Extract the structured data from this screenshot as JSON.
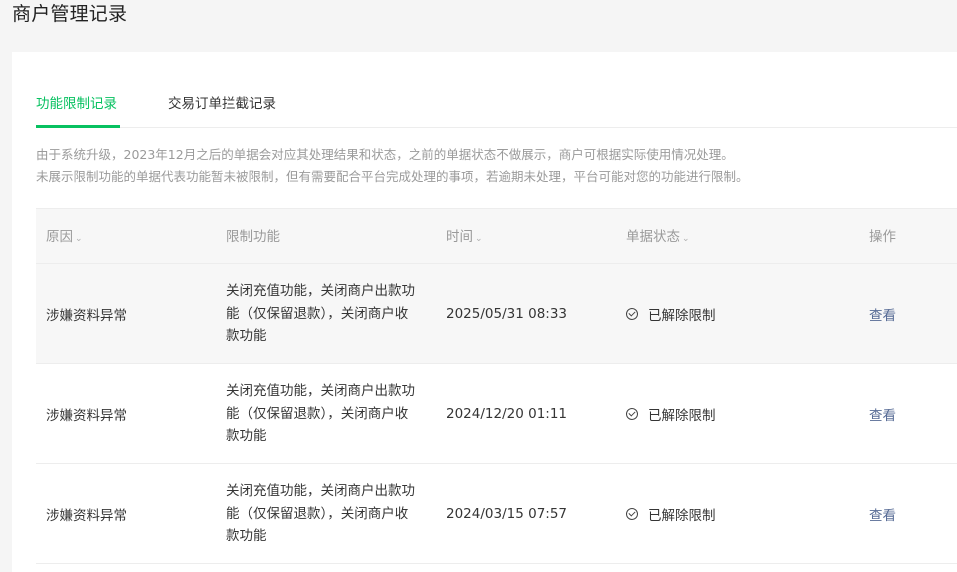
{
  "page": {
    "title": "商户管理记录"
  },
  "tabs": [
    {
      "label": "功能限制记录",
      "active": true
    },
    {
      "label": "交易订单拦截记录",
      "active": false
    }
  ],
  "notice": [
    "由于系统升级，2023年12月之后的单据会对应其处理结果和状态，之前的单据状态不做展示，商户可根据实际使用情况处理。",
    "未展示限制功能的单据代表功能暂未被限制，但有需要配合平台完成处理的事项，若逾期未处理，平台可能对您的功能进行限制。"
  ],
  "table": {
    "headers": [
      "原因",
      "限制功能",
      "时间",
      "单据状态",
      "操作"
    ],
    "sortable": [
      true,
      false,
      true,
      true,
      false
    ],
    "rows": [
      {
        "reason": "涉嫌资料异常",
        "func_lines": [
          "关闭充值功能，关闭商户出款功",
          "能（仅保留退款），关闭商户收",
          "款功能"
        ],
        "time": "2025/05/31 08:33",
        "status": "已解除限制",
        "action": "查看"
      },
      {
        "reason": "涉嫌资料异常",
        "func_lines": [
          "关闭充值功能，关闭商户出款功",
          "能（仅保留退款），关闭商户收",
          "款功能"
        ],
        "time": "2024/12/20 01:11",
        "status": "已解除限制",
        "action": "查看"
      },
      {
        "reason": "涉嫌资料异常",
        "func_lines": [
          "关闭充值功能，关闭商户出款功",
          "能（仅保留退款），关闭商户收",
          "款功能"
        ],
        "time": "2024/03/15 07:57",
        "status": "已解除限制",
        "action": "查看"
      }
    ]
  },
  "colors": {
    "accent": "#07c160",
    "link": "#576b95",
    "muted": "#9a9a9a"
  },
  "icons": {
    "status": "check-circle-icon",
    "sort": "chevron-down-icon"
  }
}
